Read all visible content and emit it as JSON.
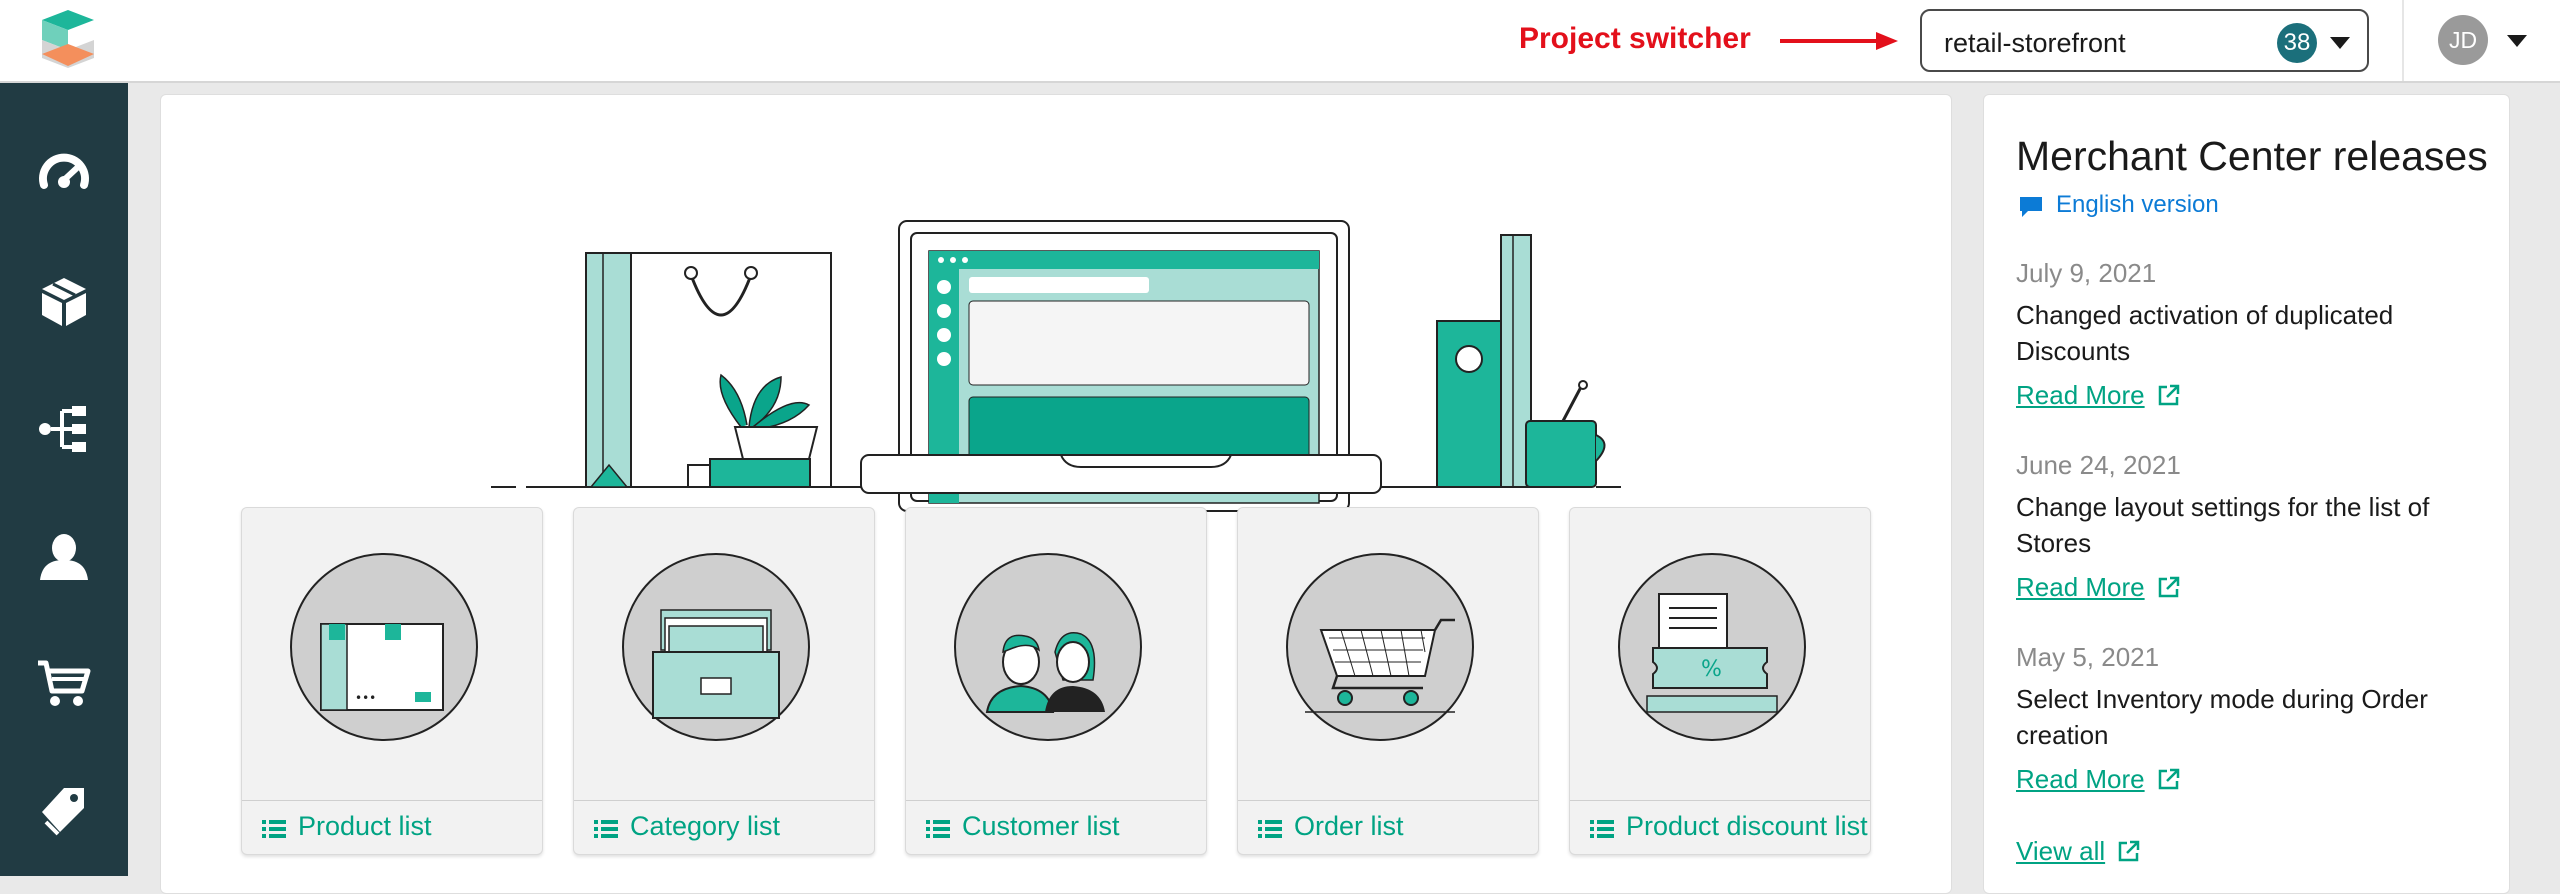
{
  "header": {
    "annotation_label": "Project switcher",
    "project": {
      "name": "retail-storefront",
      "badge": "38"
    },
    "user": {
      "initials": "JD"
    }
  },
  "sidebar": {
    "items": [
      {
        "name": "dashboard",
        "icon": "speedometer-icon"
      },
      {
        "name": "products",
        "icon": "box-icon"
      },
      {
        "name": "categories",
        "icon": "tree-icon"
      },
      {
        "name": "customers",
        "icon": "user-icon"
      },
      {
        "name": "orders",
        "icon": "cart-icon"
      },
      {
        "name": "discounts",
        "icon": "tag-icon"
      }
    ]
  },
  "tiles": [
    {
      "label": "Product list"
    },
    {
      "label": "Category list"
    },
    {
      "label": "Customer list"
    },
    {
      "label": "Order list"
    },
    {
      "label": "Product discount list"
    }
  ],
  "releases": {
    "title": "Merchant Center releases",
    "language_link": "English version",
    "entries": [
      {
        "date": "July 9, 2021",
        "text": "Changed activation of duplicated Discounts",
        "link": "Read More"
      },
      {
        "date": "June 24, 2021",
        "text": "Change layout settings for the list of Stores",
        "link": "Read More"
      },
      {
        "date": "May 5, 2021",
        "text": "Select Inventory mode during Order creation",
        "link": "Read More"
      }
    ],
    "view_all": "View all"
  },
  "colors": {
    "brand_teal": "#00a383",
    "sidebar": "#213b43",
    "annotation_red": "#e3101b",
    "link_blue": "#0c7bd6"
  }
}
